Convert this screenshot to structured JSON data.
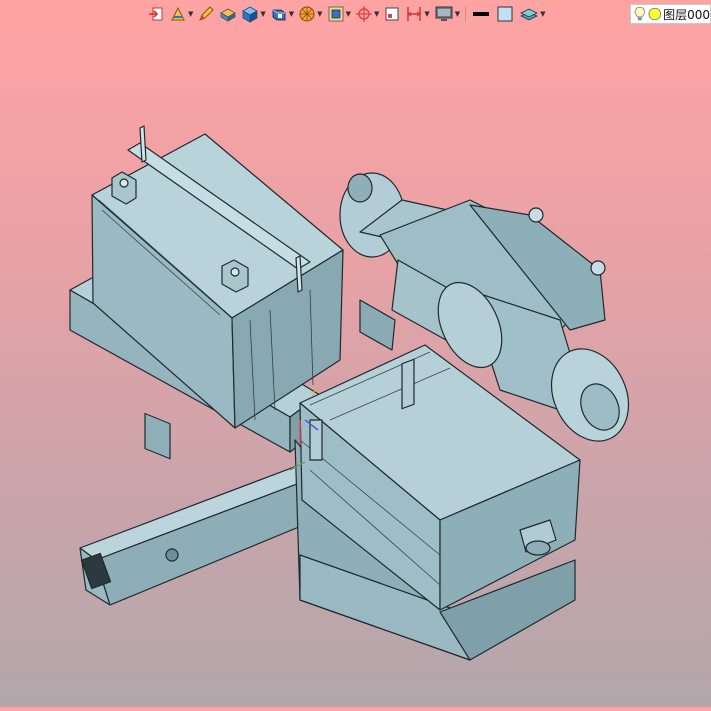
{
  "toolbar": {
    "tools": [
      {
        "name": "exit-sketch-icon",
        "dropdown": false
      },
      {
        "name": "sketch-tools-icon",
        "dropdown": true
      },
      {
        "name": "pencil-icon",
        "dropdown": false
      },
      {
        "name": "pad-icon",
        "dropdown": false
      },
      {
        "name": "part-icon",
        "dropdown": true
      },
      {
        "name": "body-icon",
        "dropdown": true
      },
      {
        "name": "wheel-icon",
        "dropdown": true
      },
      {
        "name": "frame-icon",
        "dropdown": true
      },
      {
        "name": "axis-icon",
        "dropdown": true
      },
      {
        "name": "square-icon",
        "dropdown": false
      },
      {
        "name": "dimension-icon",
        "dropdown": true
      },
      {
        "name": "monitor-icon",
        "dropdown": true
      },
      {
        "name": "line-thickness-icon",
        "dropdown": false
      },
      {
        "name": "fill-color-icon",
        "dropdown": false
      },
      {
        "name": "layers-icon",
        "dropdown": true
      }
    ],
    "colors": {
      "accent": "#2e74c9",
      "orange": "#f2a43a",
      "red": "#e04040"
    }
  },
  "layer": {
    "label": "图层000",
    "bulb_icon": "light-bulb-icon",
    "color_icon": "layer-color-icon"
  },
  "scene": {
    "model_color": "#9bbac3",
    "edge_color": "#1e2a2e"
  }
}
